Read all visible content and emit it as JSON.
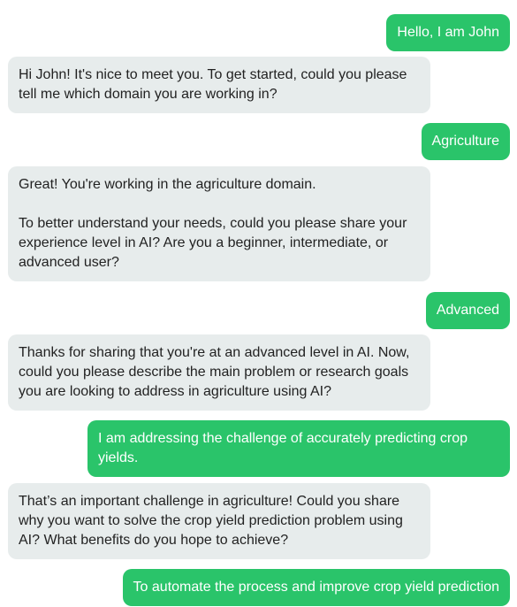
{
  "messages": [
    {
      "role": "user",
      "text": "Hello, I am John"
    },
    {
      "role": "bot",
      "text": "Hi John! It's nice to meet you. To get started, could you please tell me which domain you are working in?"
    },
    {
      "role": "user",
      "text": "Agriculture"
    },
    {
      "role": "bot",
      "text": "Great! You're working in the agriculture domain.\n\nTo better understand your needs, could you please share your experience level in AI? Are you a beginner, intermediate, or advanced user?"
    },
    {
      "role": "user",
      "text": "Advanced"
    },
    {
      "role": "bot",
      "text": "Thanks for sharing that you're at an advanced level in AI. Now, could you please describe the main problem or research goals you are looking to address in agriculture using AI?"
    },
    {
      "role": "user",
      "text": "I am addressing the challenge of accurately predicting crop yields."
    },
    {
      "role": "bot",
      "text": "That’s an important challenge in agriculture! Could you share why you want to solve the crop yield prediction problem using AI? What benefits do you hope to achieve?"
    },
    {
      "role": "user",
      "text": "To automate the process and improve crop yield prediction"
    }
  ]
}
